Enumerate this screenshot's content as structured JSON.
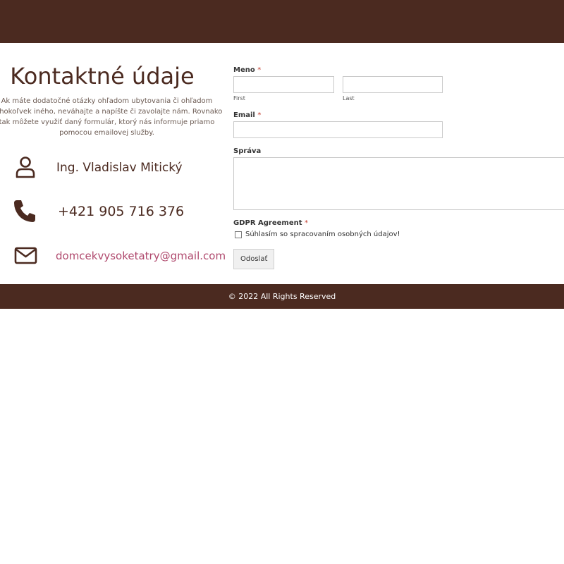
{
  "header": {},
  "contact": {
    "title": "Kontaktné údaje",
    "intro": "Ak máte dodatočné otázky ohľadom ubytovania či ohľadom čohokoľvek iného, neváhajte a napíšte či zavolajte nám. Rovnako tak môžete využiť daný formulár, ktorý nás informuje priamo pomocou emailovej služby.",
    "name": "Ing. Vladislav Mitický",
    "phone": "+421 905 716 376",
    "email": "domcekvysoketatry@gmail.com",
    "icons": {
      "person": "person-icon",
      "phone": "phone-icon",
      "mail": "envelope-icon"
    }
  },
  "form": {
    "name_label": "Meno",
    "required_mark": "*",
    "first_sublabel": "First",
    "last_sublabel": "Last",
    "email_label": "Email",
    "message_label": "Správa",
    "gdpr_label": "GDPR Agreement",
    "gdpr_checkbox_label": "Súhlasím so spracovaním osobných údajov!",
    "gdpr_checked": false,
    "first_value": "",
    "last_value": "",
    "email_value": "",
    "message_value": "",
    "submit_label": "Odoslať"
  },
  "footer": {
    "copyright": "© 2022 All Rights Reserved"
  },
  "colors": {
    "brand": "#4b2a20",
    "link": "#b04a6e",
    "required": "#c0392b"
  }
}
